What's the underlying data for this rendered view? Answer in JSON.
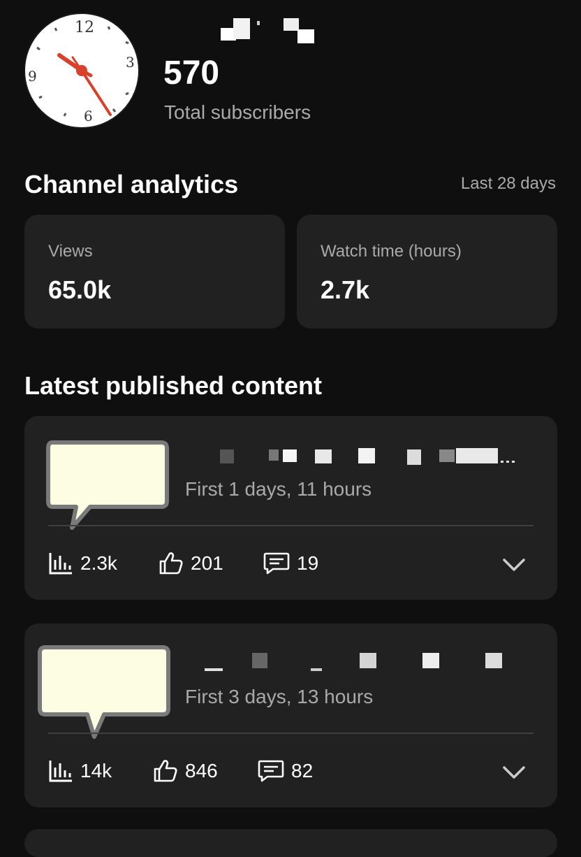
{
  "header": {
    "subscriber_count": "570",
    "subscriber_label": "Total subscribers"
  },
  "analytics": {
    "title": "Channel analytics",
    "range": "Last 28 days",
    "metrics": [
      {
        "label": "Views",
        "value": "65.0k"
      },
      {
        "label": "Watch time (hours)",
        "value": "2.7k"
      }
    ]
  },
  "latest": {
    "title": "Latest published content",
    "items": [
      {
        "subtitle": "First 1 days, 11 hours",
        "views": "2.3k",
        "likes": "201",
        "comments": "19"
      },
      {
        "subtitle": "First 3 days, 13 hours",
        "views": "14k",
        "likes": "846",
        "comments": "82"
      }
    ]
  },
  "icons": {
    "avatar": "clock-icon",
    "views": "bar-chart-icon",
    "likes": "thumbs-up-icon",
    "comments": "comment-icon",
    "expand": "chevron-down-icon",
    "thumbnail": "speech-bubble-icon"
  },
  "colors": {
    "background": "#0f0f0f",
    "card": "#212121",
    "secondary_text": "#aaaaaa",
    "clock_hand": "#d9412b",
    "thumbnail_fill": "#fdfde3"
  }
}
